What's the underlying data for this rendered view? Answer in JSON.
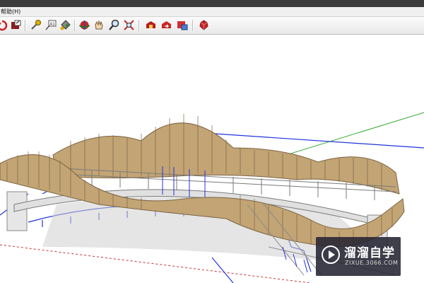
{
  "menu": {
    "help_label": "帮助(H)"
  },
  "toolbar": {
    "buttons": [
      {
        "name": "undo-icon"
      },
      {
        "name": "layout-icon"
      },
      {
        "name": "measure-tape-icon"
      },
      {
        "name": "text-label-icon"
      },
      {
        "name": "paint-bucket-icon"
      },
      {
        "name": "orbit-icon"
      },
      {
        "name": "pan-hand-icon"
      },
      {
        "name": "zoom-icon"
      },
      {
        "name": "zoom-extents-icon"
      },
      {
        "name": "warehouse-get-models-icon"
      },
      {
        "name": "warehouse-share-model-icon"
      },
      {
        "name": "share-component-icon"
      },
      {
        "name": "extension-ruby-icon"
      }
    ]
  },
  "watermark": {
    "title": "溜溜自学",
    "url": "ZIXUE.3066.COM"
  },
  "colors": {
    "wood": "#c2a475",
    "wood_dark": "#7d6340",
    "blue_edges": "#2233dd",
    "axis_green": "#33aa33",
    "axis_red": "#cc3333"
  }
}
